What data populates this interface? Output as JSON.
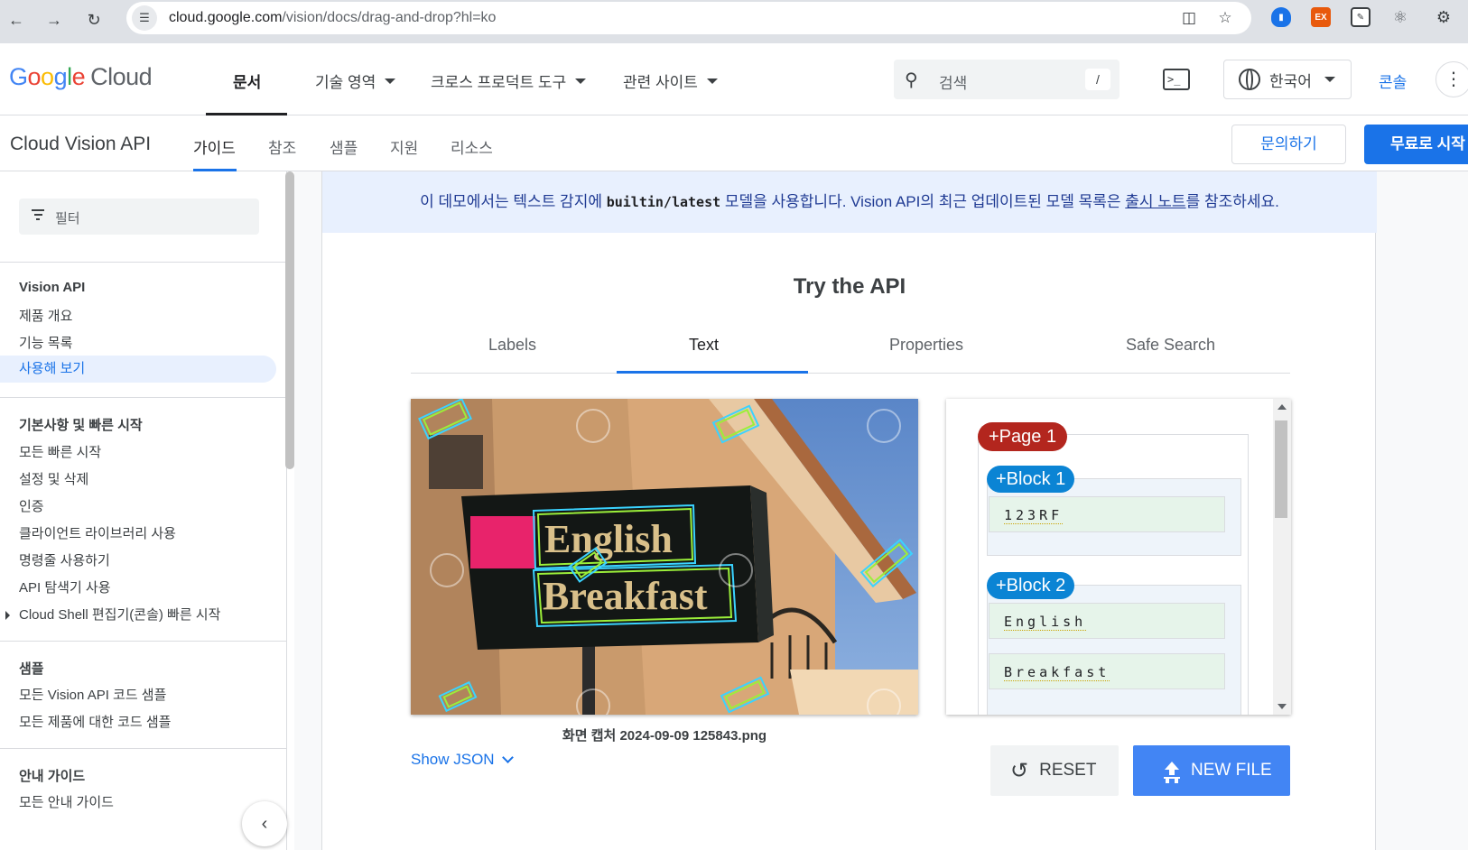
{
  "browser": {
    "url_host": "cloud.google.com",
    "url_path": "/vision/docs/drag-and-drop?hl=ko",
    "ext_ex_label": "EX"
  },
  "header": {
    "logo_google": [
      "G",
      "o",
      "o",
      "g",
      "l",
      "e"
    ],
    "logo_cloud": "Cloud",
    "nav": [
      "문서",
      "기술 영역",
      "크로스 프로덕트 도구",
      "관련 사이트"
    ],
    "search_placeholder": "검색",
    "search_shortcut": "/",
    "terminal_glyph": ">_",
    "language": "한국어",
    "console": "콘솔"
  },
  "product": {
    "title": "Cloud Vision API",
    "tabs": [
      "가이드",
      "참조",
      "샘플",
      "지원",
      "리소스"
    ],
    "contact": "문의하기",
    "start_free": "무료로 시작"
  },
  "sidebar": {
    "filter_placeholder": "필터",
    "sections": [
      {
        "heading": "Vision API",
        "items": [
          "제품 개요",
          "기능 목록",
          "사용해 보기"
        ]
      },
      {
        "heading": "기본사항 및 빠른 시작",
        "items": [
          "모든 빠른 시작",
          "설정 및 삭제",
          "인증",
          "클라이언트 라이브러리 사용",
          "명령줄 사용하기",
          "API 탐색기 사용",
          "Cloud Shell 편집기(콘솔) 빠른 시작"
        ]
      },
      {
        "heading": "샘플",
        "items": [
          "모든 Vision API 코드 샘플",
          "모든 제품에 대한 코드 샘플"
        ]
      },
      {
        "heading": "안내 가이드",
        "items": [
          "모든 안내 가이드"
        ]
      }
    ],
    "active_item": "사용해 보기"
  },
  "banner": {
    "prefix": "이 데모에서는 텍스트 감지에 ",
    "model": "builtin/latest",
    "middle": " 모델을 사용합니다. Vision API의 최근 업데이트된 모델 목록은 ",
    "link": "출시 노트",
    "suffix": "를 참조하세요."
  },
  "demo": {
    "title": "Try the API",
    "tabs": [
      "Labels",
      "Text",
      "Properties",
      "Safe Search"
    ],
    "active_tab": "Text",
    "image": {
      "sign_line1": "English",
      "sign_line2": "Breakfast",
      "watermark": "123RF"
    },
    "caption": "화면 캡처 2024-09-09 125843.png",
    "results": {
      "page_label": "+Page 1",
      "blocks": [
        {
          "label": "+Block 1",
          "words": [
            "123RF"
          ]
        },
        {
          "label": "+Block 2",
          "words": [
            "English",
            "Breakfast"
          ]
        }
      ]
    },
    "show_json": "Show JSON",
    "reset": "RESET",
    "new_file": "NEW FILE"
  },
  "colors": {
    "accent": "#1a73e8",
    "page_pill": "#b3261e",
    "block_pill": "#0b84d4",
    "new_file_button": "#4285f4"
  }
}
